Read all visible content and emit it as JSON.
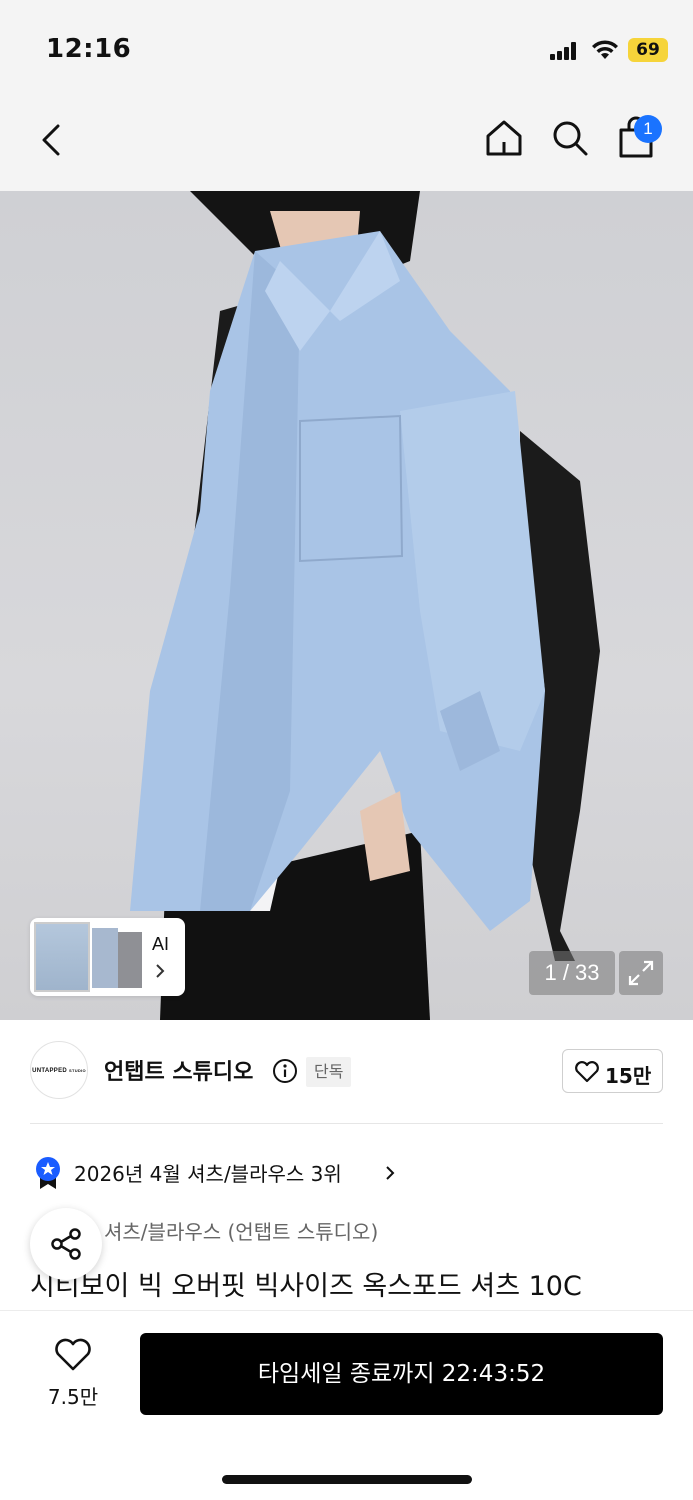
{
  "status_bar": {
    "time": "12:16",
    "battery": "69"
  },
  "nav": {
    "cart_count": "1"
  },
  "gallery": {
    "ai_label": "AI",
    "page_counter": "1 / 33"
  },
  "brand": {
    "logo_text": "UNTAPPED",
    "logo_subtext": "STUDIO",
    "name": "언탭트 스튜디오",
    "badge": "단독",
    "likes": "15만"
  },
  "ranking": {
    "text": "2026년 4월 셔츠/블라우스 3위"
  },
  "product": {
    "category": "셔츠/블라우스 (언탭트 스튜디오)",
    "title": "시티보이 빅 오버핏 빅사이즈 옥스포드 셔츠 10C"
  },
  "bottom_bar": {
    "wish_count": "7.5만",
    "buy_label": "타임세일 종료까지 22:43:52"
  },
  "colors": {
    "accent": "#1a73ff",
    "battery": "#f6d43a",
    "button": "#000000",
    "shirt": "#a9c4e6"
  }
}
